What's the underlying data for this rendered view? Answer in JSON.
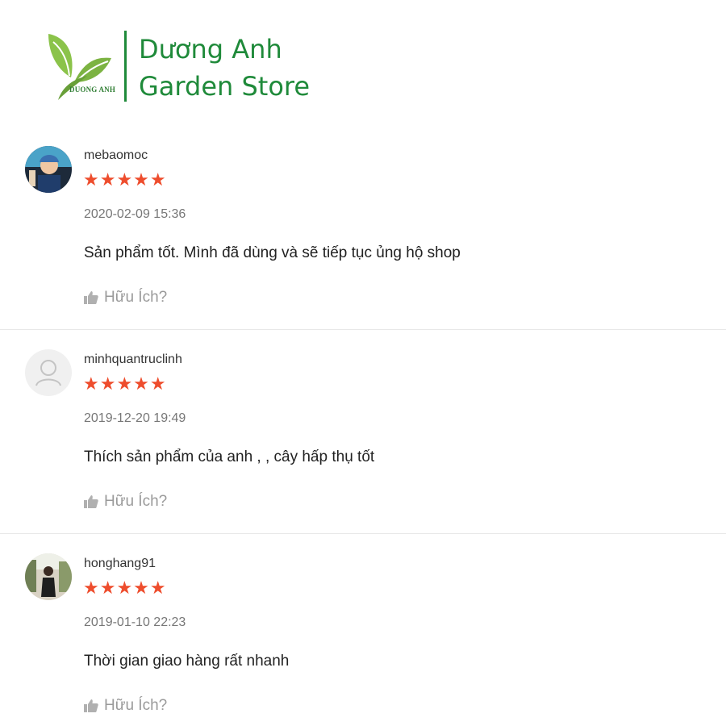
{
  "brand": {
    "logo_text": "DUONG ANH",
    "name_line1": "Dương Anh",
    "name_line2": "Garden Store",
    "color": "#1f8a3a"
  },
  "rating_color": "#ee4d2d",
  "reviews": [
    {
      "username": "mebaomoc",
      "stars": "★★★★★",
      "rating": 5,
      "timestamp": "2020-02-09 15:36",
      "comment": "Sản phẩm tốt. Mình đã dùng và sẽ tiếp tục ủng hộ shop",
      "helpful_label": "Hữu Ích?",
      "avatar": "photo"
    },
    {
      "username": "minhquantruclinh",
      "stars": "★★★★★",
      "rating": 5,
      "timestamp": "2019-12-20 19:49",
      "comment": "Thích sản phẩm của anh , , cây hấp thụ tốt",
      "helpful_label": "Hữu Ích?",
      "avatar": "user-placeholder-icon"
    },
    {
      "username": "honghang91",
      "stars": "★★★★★",
      "rating": 5,
      "timestamp": "2019-01-10 22:23",
      "comment": "Thời gian giao hàng rất nhanh",
      "helpful_label": "Hữu Ích?",
      "avatar": "photo"
    }
  ]
}
